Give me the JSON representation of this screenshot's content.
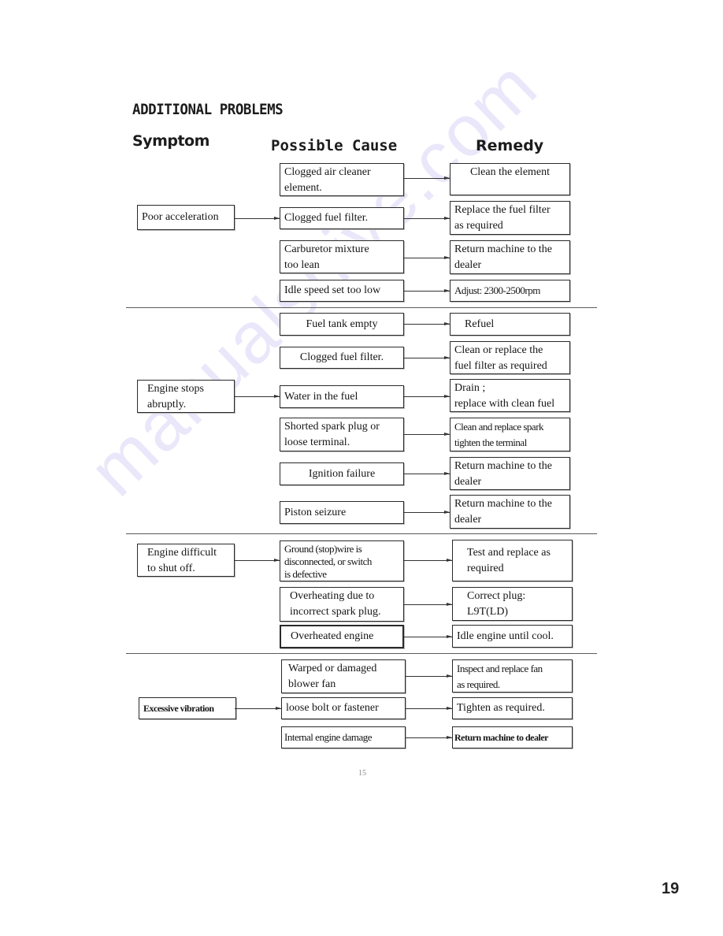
{
  "page": {
    "title": "ADDITIONAL PROBLEMS",
    "columns": {
      "symptom": "Symptom",
      "cause": "Possible Cause",
      "remedy": "Remedy"
    },
    "watermark": "manualshive.com",
    "printed_page_number": "15",
    "page_number": "19"
  },
  "sections": [
    {
      "symptom": "Poor acceleration",
      "rows": [
        {
          "cause": "Clogged air cleaner\nelement.",
          "remedy": "Clean the element"
        },
        {
          "cause": "Clogged fuel filter.",
          "remedy": "Replace the fuel filter\n as required"
        },
        {
          "cause": "Carburetor mixture\ntoo lean",
          "remedy": " Return machine to the\ndealer"
        },
        {
          "cause": "Idle speed set too low",
          "remedy": "Adjust: 2300-2500rpm"
        }
      ]
    },
    {
      "symptom": "Engine stops\nabruptly.",
      "rows": [
        {
          "cause": "Fuel tank empty",
          "remedy": "Refuel"
        },
        {
          "cause": "Clogged fuel filter.",
          "remedy": "Clean or replace the\n fuel filter as required"
        },
        {
          "cause": "Water in the fuel",
          "remedy": " Drain ;\nreplace with clean fuel"
        },
        {
          "cause": "Shorted spark plug or\nloose terminal.",
          "remedy": "Clean and replace spark\ntighten the terminal"
        },
        {
          "cause": "Ignition failure",
          "remedy": "Return machine to the\ndealer"
        },
        {
          "cause": "Piston seizure",
          "remedy": "Return machine to the\ndealer"
        }
      ]
    },
    {
      "symptom": "Engine difficult\nto shut off.",
      "rows": [
        {
          "cause": "Ground (stop)wire is\ndisconnected, or switch\nis defective",
          "remedy": "Test and replace as\nrequired"
        },
        {
          "cause": "Overheating due to\nincorrect spark plug.",
          "remedy": "Correct plug:\nL9T(LD)"
        },
        {
          "cause": "Overheated engine",
          "remedy": "Idle engine until cool."
        }
      ]
    },
    {
      "symptom": "Excessive vibration",
      "rows": [
        {
          "cause": "Warped or damaged\n blower fan",
          "remedy": "Inspect and replace fan\nas required."
        },
        {
          "cause": "loose bolt or fastener",
          "remedy": "Tighten as required."
        },
        {
          "cause": "Internal engine damage",
          "remedy": "Return machine to dealer"
        }
      ]
    }
  ]
}
